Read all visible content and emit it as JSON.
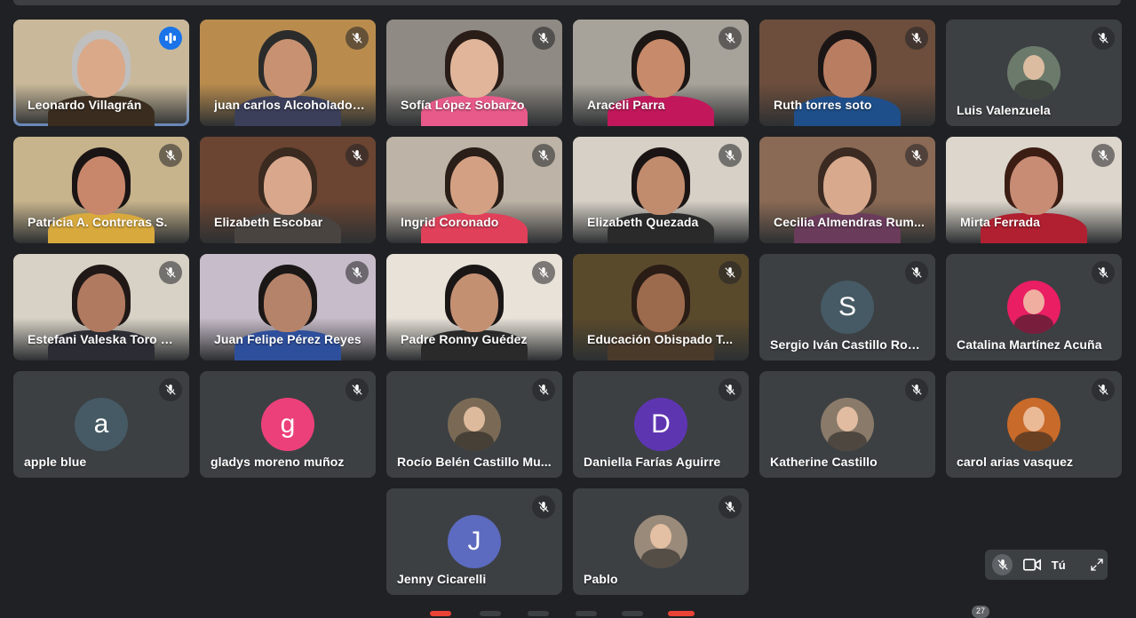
{
  "participants": [
    {
      "name": "Leonardo Villagrán",
      "type": "video",
      "speaking": true,
      "bg": "#c9b99a",
      "skin": "#d9a98a",
      "hair": "#bfbfbf",
      "shirt": "#3a2d20"
    },
    {
      "name": "juan carlos Alcoholado ...",
      "type": "video",
      "bg": "#b98c4e",
      "skin": "#c89272",
      "hair": "#2b2b2b",
      "shirt": "#3b3f5a"
    },
    {
      "name": "Sofía López Sobarzo",
      "type": "video",
      "bg": "#8f8a83",
      "skin": "#e0b59a",
      "hair": "#2a1c17",
      "shirt": "#e85a8a"
    },
    {
      "name": "Araceli Parra",
      "type": "video",
      "bg": "#a8a39a",
      "skin": "#c78a6a",
      "hair": "#1c1614",
      "shirt": "#c2185b"
    },
    {
      "name": "Ruth torres soto",
      "type": "video",
      "bg": "#6d4e3c",
      "skin": "#b97d62",
      "hair": "#1b1615",
      "shirt": "#1f4f8a"
    },
    {
      "name": "Luis Valenzuela",
      "type": "avatar",
      "avatar_kind": "photo",
      "avatar_color": "#6b7a6b"
    },
    {
      "name": "Patricia A. Contreras S.",
      "type": "video",
      "bg": "#c7b48c",
      "skin": "#c8866b",
      "hair": "#1a1414",
      "shirt": "#d8a93c"
    },
    {
      "name": "Elizabeth Escobar",
      "type": "video",
      "bg": "#6b4532",
      "skin": "#d9a88c",
      "hair": "#3a2a20",
      "shirt": "#4a4440"
    },
    {
      "name": "Ingrid Coronado",
      "type": "video",
      "bg": "#bdb3a6",
      "skin": "#d4a083",
      "hair": "#2a1e18",
      "shirt": "#e0405a"
    },
    {
      "name": "Elizabeth Quezada",
      "type": "video",
      "bg": "#d6d0c6",
      "skin": "#c18b6e",
      "hair": "#1a1414",
      "shirt": "#2a2a2a"
    },
    {
      "name": "Cecilia Almendras Rum...",
      "type": "video",
      "bg": "#8a6a55",
      "skin": "#d8a98c",
      "hair": "#3a2a22",
      "shirt": "#6a3b5a"
    },
    {
      "name": "Mirta Ferrada",
      "type": "video",
      "bg": "#ddd6cc",
      "skin": "#c88b74",
      "hair": "#3b1d14",
      "shirt": "#b02030"
    },
    {
      "name": "Estefani Valeska Toro U...",
      "type": "video",
      "bg": "#d8d2c6",
      "skin": "#b07a60",
      "hair": "#201816",
      "shirt": "#2c2c34"
    },
    {
      "name": "Juan Felipe Pérez Reyes",
      "type": "video",
      "bg": "#c7bcc9",
      "skin": "#b5836a",
      "hair": "#1b1717",
      "shirt": "#2e4f9c"
    },
    {
      "name": "Padre Ronny Guédez",
      "type": "video",
      "bg": "#e8e2d8",
      "skin": "#c49072",
      "hair": "#1a1616",
      "shirt": "#2a2a2a"
    },
    {
      "name": "Educación Obispado T...",
      "type": "video",
      "bg": "#5a4a2c",
      "skin": "#9c6a4c",
      "hair": "#2a1d16",
      "shirt": "#4a3a2a"
    },
    {
      "name": "Sergio Iván Castillo Rodr...",
      "type": "avatar",
      "avatar_kind": "letter",
      "letter": "S",
      "avatar_color": "#455a64"
    },
    {
      "name": "Catalina Martínez Acuña",
      "type": "avatar",
      "avatar_kind": "photo",
      "avatar_color": "#e91e63"
    },
    {
      "name": "apple blue",
      "type": "avatar",
      "avatar_kind": "letter",
      "letter": "a",
      "avatar_color": "#455a64"
    },
    {
      "name": "gladys moreno muñoz",
      "type": "avatar",
      "avatar_kind": "letter",
      "letter": "g",
      "avatar_color": "#ec407a"
    },
    {
      "name": "Rocío Belén Castillo Mu...",
      "type": "avatar",
      "avatar_kind": "photo",
      "avatar_color": "#7a6a55"
    },
    {
      "name": "Daniella Farías Aguirre",
      "type": "avatar",
      "avatar_kind": "letter",
      "letter": "D",
      "avatar_color": "#5e35b1"
    },
    {
      "name": "Katherine Castillo",
      "type": "avatar",
      "avatar_kind": "photo",
      "avatar_color": "#8a7a6a"
    },
    {
      "name": "carol arias vasquez",
      "type": "avatar",
      "avatar_kind": "photo",
      "avatar_color": "#c86a2a"
    },
    {
      "name": "Jenny Cicarelli",
      "type": "avatar",
      "avatar_kind": "letter",
      "letter": "J",
      "avatar_color": "#5c6bc0"
    },
    {
      "name": "Pablo",
      "type": "avatar",
      "avatar_kind": "photo",
      "avatar_color": "#9a8a7a"
    }
  ],
  "self_view": {
    "label": "Tú"
  },
  "participant_count": "27"
}
